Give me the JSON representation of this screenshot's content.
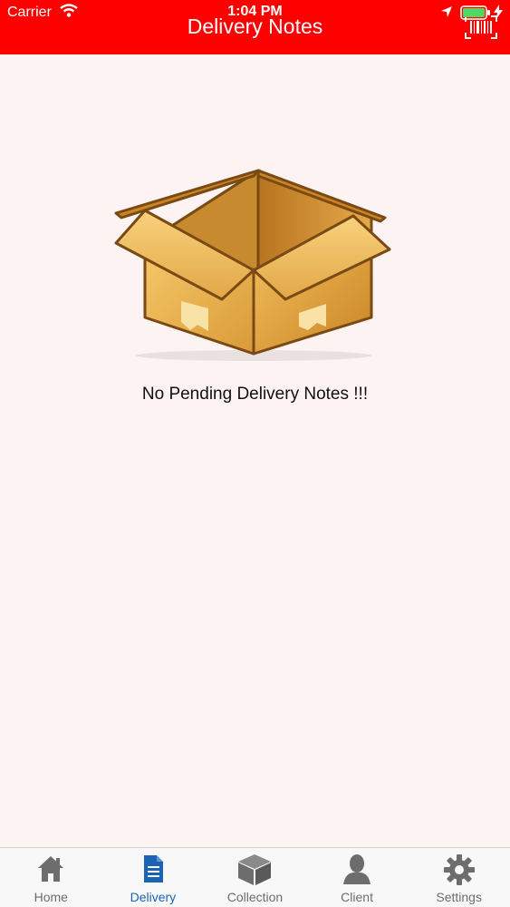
{
  "status_bar": {
    "carrier": "Carrier",
    "time": "1:04 PM"
  },
  "header": {
    "title": "Delivery Notes",
    "background_color": "#ff0000",
    "action_icon": "barcode-scanner-icon"
  },
  "main": {
    "illustration": "open-cardboard-box",
    "empty_message": "No Pending Delivery Notes !!!"
  },
  "tabs": [
    {
      "label": "Home",
      "icon": "home-icon",
      "active": false
    },
    {
      "label": "Delivery",
      "icon": "document-icon",
      "active": true
    },
    {
      "label": "Collection",
      "icon": "cube-icon",
      "active": false
    },
    {
      "label": "Client",
      "icon": "person-icon",
      "active": false
    },
    {
      "label": "Settings",
      "icon": "gear-icon",
      "active": false
    }
  ],
  "colors": {
    "active_tab": "#1a63b5",
    "inactive_tab": "#6d6d6d",
    "background": "#fdf3f3"
  }
}
